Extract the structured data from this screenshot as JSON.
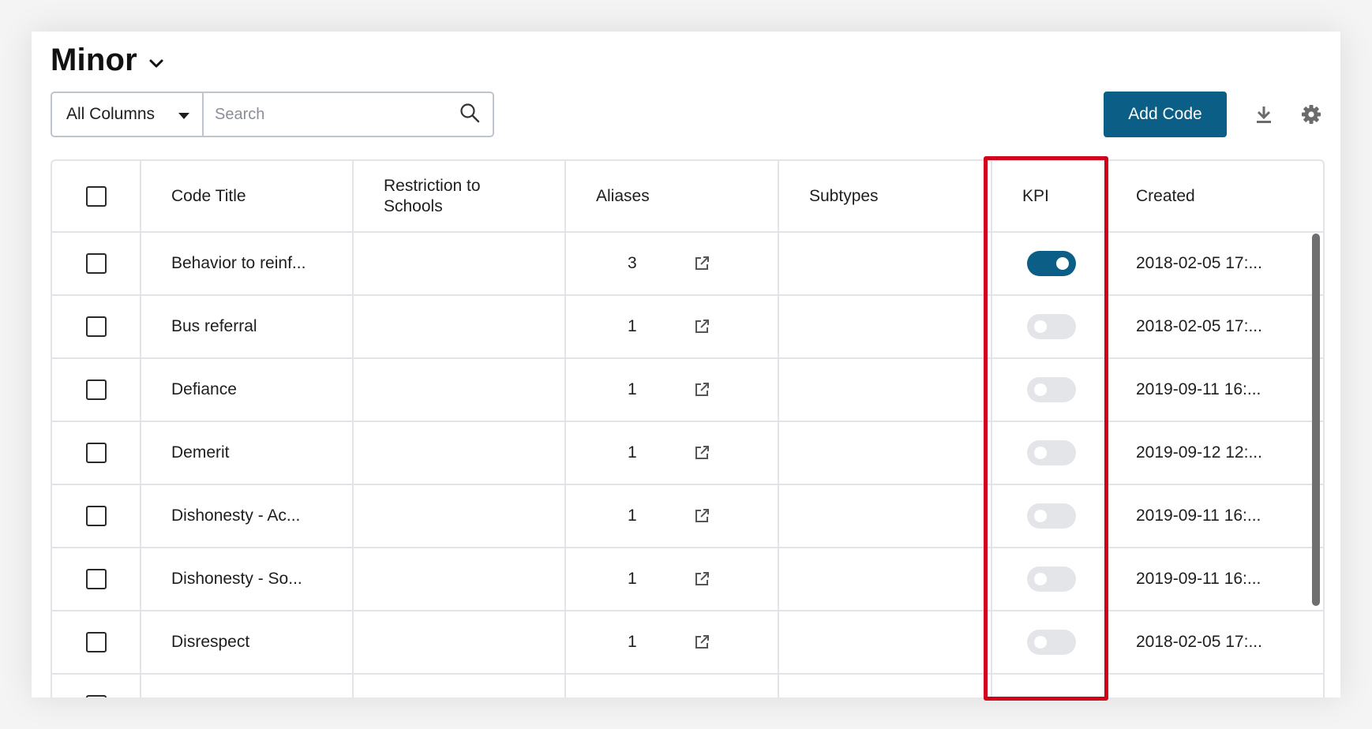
{
  "page": {
    "title": "Minor"
  },
  "filter": {
    "column_select_value": "All Columns",
    "search_placeholder": "Search",
    "search_value": ""
  },
  "actions": {
    "add_code_label": "Add Code",
    "download_icon": "download-icon",
    "settings_icon": "gear-icon"
  },
  "table": {
    "headers": {
      "code_title": "Code Title",
      "restriction_line1": "Restriction to",
      "restriction_line2": "Schools",
      "aliases": "Aliases",
      "subtypes": "Subtypes",
      "kpi": "KPI",
      "created": "Created"
    },
    "rows": [
      {
        "code_title": "Behavior to reinf...",
        "restriction": "",
        "aliases": "3",
        "subtypes": "",
        "kpi": true,
        "created": "2018-02-05 17:..."
      },
      {
        "code_title": "Bus referral",
        "restriction": "",
        "aliases": "1",
        "subtypes": "",
        "kpi": false,
        "created": "2018-02-05 17:..."
      },
      {
        "code_title": "Defiance",
        "restriction": "",
        "aliases": "1",
        "subtypes": "",
        "kpi": false,
        "created": "2019-09-11 16:..."
      },
      {
        "code_title": "Demerit",
        "restriction": "",
        "aliases": "1",
        "subtypes": "",
        "kpi": false,
        "created": "2019-09-12 12:..."
      },
      {
        "code_title": "Dishonesty - Ac...",
        "restriction": "",
        "aliases": "1",
        "subtypes": "",
        "kpi": false,
        "created": "2019-09-11 16:..."
      },
      {
        "code_title": "Dishonesty - So...",
        "restriction": "",
        "aliases": "1",
        "subtypes": "",
        "kpi": false,
        "created": "2019-09-11 16:..."
      },
      {
        "code_title": "Disrespect",
        "restriction": "",
        "aliases": "1",
        "subtypes": "",
        "kpi": false,
        "created": "2018-02-05 17:..."
      },
      {
        "code_title": "",
        "restriction": "",
        "aliases": "",
        "subtypes": "",
        "kpi": false,
        "created": ""
      }
    ]
  },
  "colors": {
    "accent": "#0b5e86",
    "highlight": "#d0021b",
    "toggle_off": "#e3e5e8"
  }
}
